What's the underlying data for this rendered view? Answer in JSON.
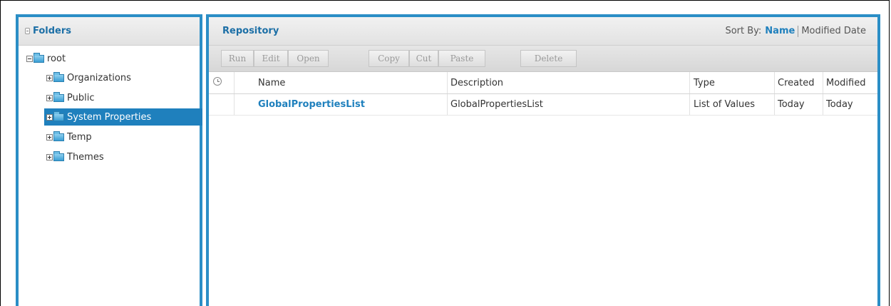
{
  "folders": {
    "title": "Folders",
    "tree": {
      "root": "root",
      "children": [
        "Organizations",
        "Public",
        "System Properties",
        "Temp",
        "Themes"
      ],
      "selected": "System Properties"
    }
  },
  "repository": {
    "title": "Repository",
    "sort": {
      "label": "Sort By:",
      "name": "Name",
      "modified": "Modified Date"
    },
    "toolbar": {
      "run": "Run",
      "edit": "Edit",
      "open": "Open",
      "copy": "Copy",
      "cut": "Cut",
      "paste": "Paste",
      "delete": "Delete"
    },
    "columns": {
      "name": "Name",
      "description": "Description",
      "type": "Type",
      "created": "Created",
      "modified": "Modified"
    },
    "rows": [
      {
        "name": "GlobalPropertiesList",
        "description": "GlobalPropertiesList",
        "type": "List of Values",
        "created": "Today",
        "modified": "Today"
      }
    ]
  },
  "colors": {
    "accent": "#2b8ec6",
    "selected": "#1f80bd",
    "link": "#1f80bd"
  },
  "icons": [
    "clock-icon",
    "folder-icon",
    "expander-plus-icon",
    "expander-minus-icon",
    "collapse-toggle-icon"
  ]
}
